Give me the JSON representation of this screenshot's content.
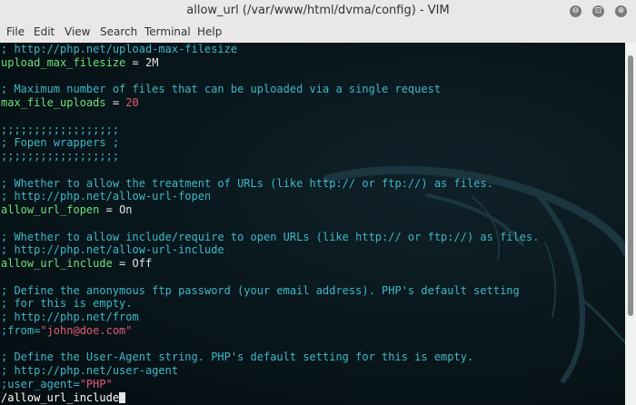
{
  "window": {
    "title": "allow_url (/var/www/html/dvma/config) - VIM",
    "controls": {
      "minimize": "⊖",
      "maximize": "⊡",
      "close": "⊗"
    }
  },
  "menu": {
    "items": [
      "File",
      "Edit",
      "View",
      "Search",
      "Terminal",
      "Help"
    ]
  },
  "editor": {
    "lines": [
      {
        "type": "comment",
        "text": "; http://php.net/upload-max-filesize"
      },
      {
        "type": "kv",
        "key": "upload_max_filesize",
        "value": "2M",
        "value_type": "val"
      },
      {
        "type": "blank",
        "text": ""
      },
      {
        "type": "comment",
        "text": "; Maximum number of files that can be uploaded via a single request"
      },
      {
        "type": "kv",
        "key": "max_file_uploads",
        "value": "20",
        "value_type": "num"
      },
      {
        "type": "blank",
        "text": ""
      },
      {
        "type": "comment",
        "text": ";;;;;;;;;;;;;;;;;;"
      },
      {
        "type": "comment",
        "text": "; Fopen wrappers ;"
      },
      {
        "type": "comment",
        "text": ";;;;;;;;;;;;;;;;;;"
      },
      {
        "type": "blank",
        "text": ""
      },
      {
        "type": "comment",
        "text": "; Whether to allow the treatment of URLs (like http:// or ftp://) as files."
      },
      {
        "type": "comment",
        "text": "; http://php.net/allow-url-fopen"
      },
      {
        "type": "kv",
        "key": "allow_url_fopen",
        "value": "On",
        "value_type": "val"
      },
      {
        "type": "blank",
        "text": ""
      },
      {
        "type": "comment",
        "text": "; Whether to allow include/require to open URLs (like http:// or ftp://) as files."
      },
      {
        "type": "comment",
        "text": "; http://php.net/allow-url-include"
      },
      {
        "type": "kv",
        "key": "allow_url_include",
        "value": "Off",
        "value_type": "val"
      },
      {
        "type": "blank",
        "text": ""
      },
      {
        "type": "comment",
        "text": "; Define the anonymous ftp password (your email address). PHP's default setting"
      },
      {
        "type": "comment",
        "text": "; for this is empty."
      },
      {
        "type": "comment",
        "text": "; http://php.net/from"
      },
      {
        "type": "commentstr",
        "prefix": ";from=",
        "str": "\"john@doe.com\""
      },
      {
        "type": "blank",
        "text": ""
      },
      {
        "type": "comment",
        "text": "; Define the User-Agent string. PHP's default setting for this is empty."
      },
      {
        "type": "comment",
        "text": "; http://php.net/user-agent"
      },
      {
        "type": "commentstr",
        "prefix": ";user_agent=",
        "str": "\"PHP\""
      }
    ],
    "command_line": "/allow_url_include"
  },
  "colors": {
    "comment": "#3fb8c8",
    "key": "#6fe07a",
    "number": "#e05a7a",
    "string": "#e05a7a",
    "text": "#e6e6e6",
    "background": "#0b1418"
  }
}
